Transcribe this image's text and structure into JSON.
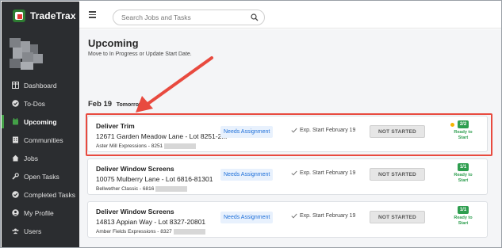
{
  "app": {
    "name": "TradeTrax"
  },
  "sidebar": {
    "items": [
      {
        "label": "Dashboard",
        "icon": "dashboard-icon",
        "active": false
      },
      {
        "label": "To-Dos",
        "icon": "check-circle-icon",
        "active": false
      },
      {
        "label": "Upcoming",
        "icon": "calendar-icon",
        "active": true
      },
      {
        "label": "Communities",
        "icon": "building-icon",
        "active": false
      },
      {
        "label": "Jobs",
        "icon": "home-icon",
        "active": false
      },
      {
        "label": "Open Tasks",
        "icon": "wrench-icon",
        "active": false
      },
      {
        "label": "Completed Tasks",
        "icon": "check-circle-icon",
        "active": false
      },
      {
        "label": "My Profile",
        "icon": "user-circle-icon",
        "active": false
      },
      {
        "label": "Users",
        "icon": "users-icon",
        "active": false
      }
    ]
  },
  "search": {
    "placeholder": "Search Jobs and Tasks"
  },
  "page": {
    "title": "Upcoming",
    "subtitle": "Move to In Progress or Update Start Date.",
    "date_heading": "Feb 19",
    "date_sub": "Tomorrow"
  },
  "tasks": [
    {
      "title": "Deliver Trim",
      "address": "12671 Garden Meadow Lane - Lot 8251-2...",
      "community": "Aster Mill Expressions - 8251",
      "assignment": "Needs Assignment",
      "exp_start": "Exp. Start February 19",
      "status": "NOT STARTED",
      "count": "2/2",
      "ready": "Ready to Start",
      "warning": true
    },
    {
      "title": "Deliver Window Screens",
      "address": "10075 Mulberry Lane - Lot 6816-81301",
      "community": "Bellwether Classic - 6816",
      "assignment": "Needs Assignment",
      "exp_start": "Exp. Start February 19",
      "status": "NOT STARTED",
      "count": "1/1",
      "ready": "Ready to Start",
      "warning": false
    },
    {
      "title": "Deliver Window Screens",
      "address": "14813 Appian Way - Lot 8327-20801",
      "community": "Amber Fields Expressions - 8327",
      "assignment": "Needs Assignment",
      "exp_start": "Exp. Start February 19",
      "status": "NOT STARTED",
      "count": "1/1",
      "ready": "Ready to Start",
      "warning": false
    }
  ],
  "colors": {
    "sidebar_bg": "#2b2d30",
    "accent_green": "#2e9e4f",
    "annotation_red": "#e84a3f",
    "link_blue": "#1e6fd9"
  }
}
